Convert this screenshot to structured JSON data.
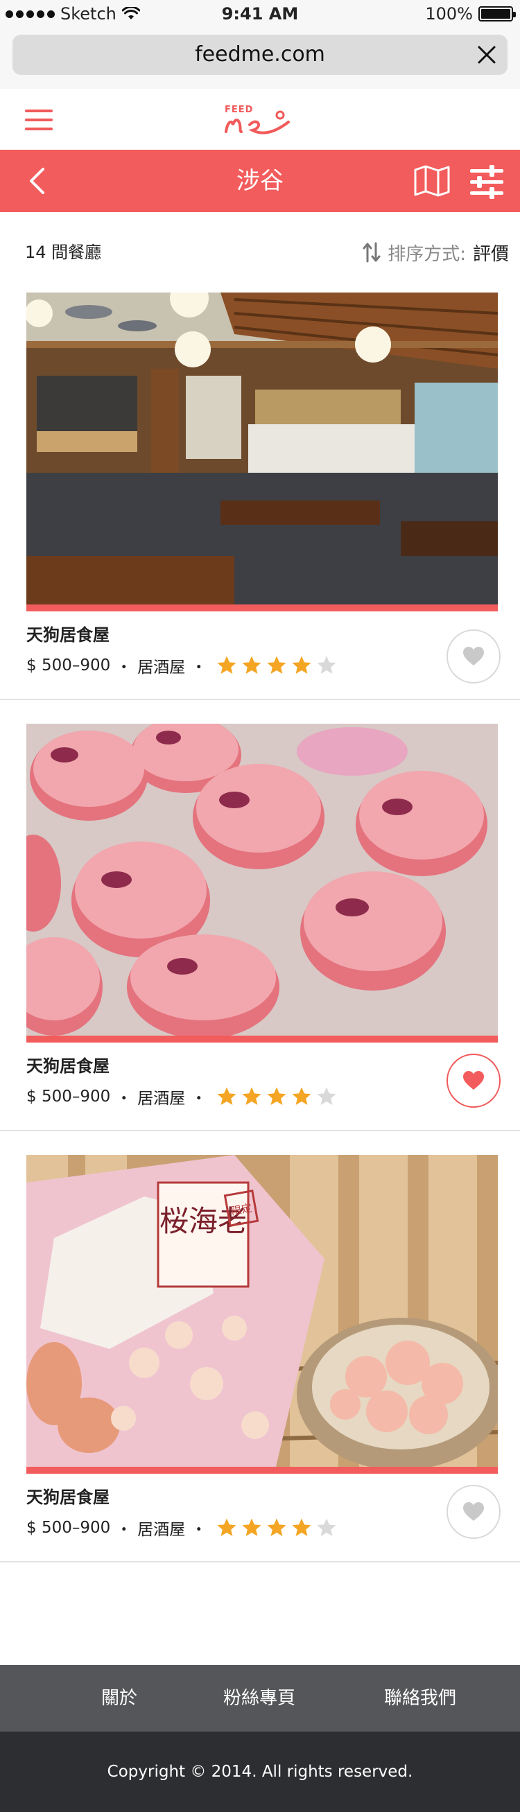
{
  "status_bar": {
    "carrier": "Sketch",
    "time": "9:41 AM",
    "battery": "100%"
  },
  "browser": {
    "url": "feedme.com"
  },
  "header": {
    "logo_text_top": "FEED",
    "logo_text_bottom": "me"
  },
  "nav": {
    "title": "涉谷"
  },
  "listing": {
    "count": "14 間餐廳",
    "sort_label": "排序方式:",
    "sort_value": "評價"
  },
  "restaurants": [
    {
      "name": "天狗居食屋",
      "price": "$ 500–900",
      "dot": "・",
      "category": "居酒屋",
      "rating": 4,
      "max_rating": 5,
      "favorited": false
    },
    {
      "name": "天狗居食屋",
      "price": "$ 500–900",
      "dot": "・",
      "category": "居酒屋",
      "rating": 4,
      "max_rating": 5,
      "favorited": true
    },
    {
      "name": "天狗居食屋",
      "price": "$ 500–900",
      "dot": "・",
      "category": "居酒屋",
      "rating": 4,
      "max_rating": 5,
      "favorited": false
    }
  ],
  "photos": {
    "snack_bag_text": "桜海老",
    "snack_stamp_text": "限定"
  },
  "footer": {
    "links": [
      "關於",
      "粉絲專頁",
      "聯絡我們"
    ],
    "copyright": "Copyright © 2014. All rights reserved."
  },
  "colors": {
    "brand_red": "#f35c5c",
    "star_on": "#f4a523",
    "star_off": "#d9d9d9",
    "footer_dark": "#2c2e31",
    "footer_mid": "#555659"
  },
  "icons": [
    "wifi-icon",
    "battery-icon",
    "close-icon",
    "menu-icon",
    "back-icon",
    "map-icon",
    "filter-icon",
    "sort-icon",
    "star-icon",
    "heart-icon"
  ]
}
